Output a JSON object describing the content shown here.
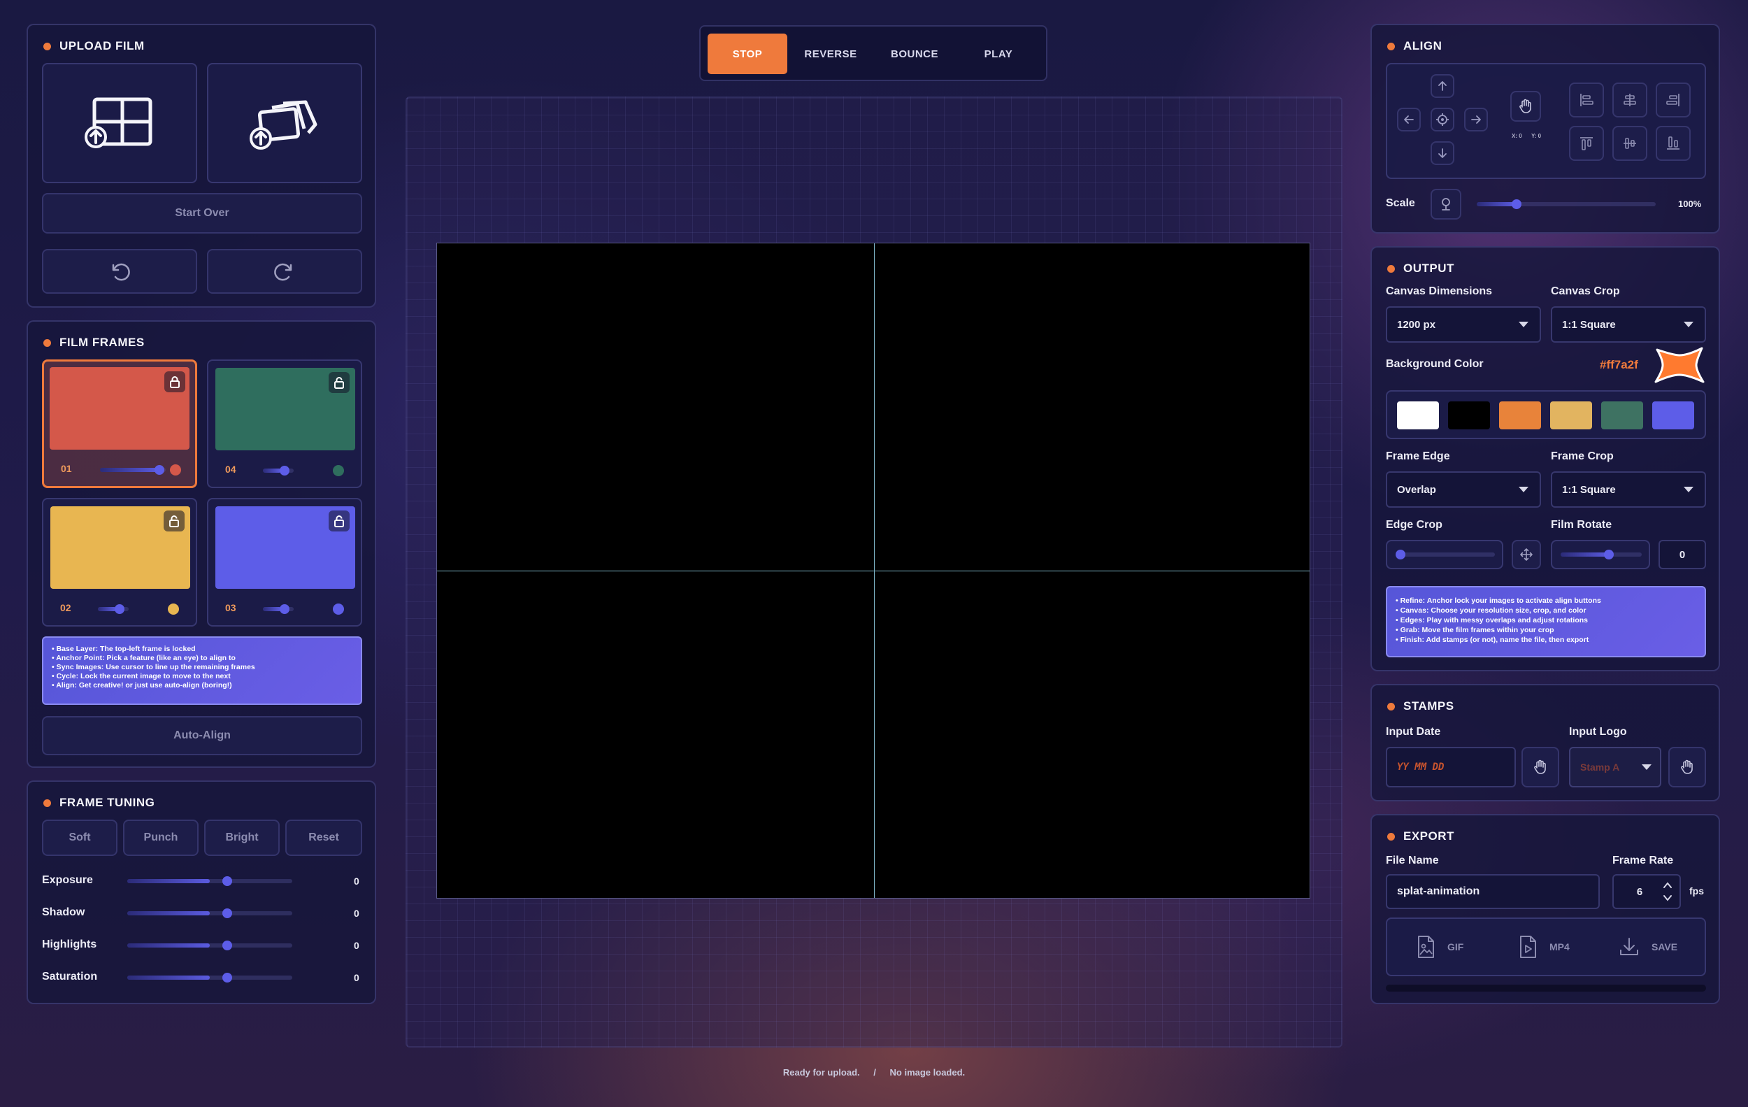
{
  "colors": {
    "accent": "#ef7a3c",
    "primary": "#5d5de8",
    "background": "#ff7a2f"
  },
  "upload": {
    "title": "UPLOAD FILM",
    "start_over": "Start Over",
    "icons": [
      "grid-upload-icon",
      "stack-upload-icon",
      "undo-icon",
      "redo-icon"
    ]
  },
  "frames": {
    "title": "FILM FRAMES",
    "items": [
      {
        "label": "01",
        "color": "#d4584a",
        "slider": 0.9
      },
      {
        "label": "04",
        "color": "#2f6e5e",
        "slider": 0.6
      },
      {
        "label": "02",
        "color": "#e8b651",
        "slider": 0.6
      },
      {
        "label": "03",
        "color": "#5d5de8",
        "slider": 0.6
      }
    ],
    "info": [
      "• Base Layer: The top-left frame is locked",
      "• Anchor Point: Pick a feature (like an eye) to align to",
      "• Sync Images: Use cursor to line up the remaining frames",
      "• Cycle: Lock the current image to move to the next",
      "• Align: Get creative! or just use auto-align (boring!)"
    ],
    "auto_align": "Auto-Align"
  },
  "tuning": {
    "title": "FRAME TUNING",
    "presets": [
      "Soft",
      "Punch",
      "Bright",
      "Reset"
    ],
    "sliders": [
      {
        "label": "Exposure",
        "value": "0",
        "level": 0.5
      },
      {
        "label": "Shadow",
        "value": "0",
        "level": 0.5
      },
      {
        "label": "Highlights",
        "value": "0",
        "level": 0.5
      },
      {
        "label": "Saturation",
        "value": "0",
        "level": 0.5
      }
    ]
  },
  "playback": {
    "tabs": [
      "STOP",
      "REVERSE",
      "BOUNCE",
      "PLAY"
    ],
    "active": "STOP"
  },
  "status": {
    "left": "Ready for upload.",
    "sep": "/",
    "right": "No image loaded."
  },
  "align": {
    "title": "ALIGN",
    "xy": [
      "X: 0",
      "Y: 0"
    ],
    "scale_label": "Scale",
    "scale_value": "100%",
    "scale_level": 0.2
  },
  "output": {
    "title": "OUTPUT",
    "canvas_dimensions_label": "Canvas Dimensions",
    "canvas_dimensions": "1200 px",
    "canvas_crop_label": "Canvas Crop",
    "canvas_crop": "1:1 Square",
    "bg_label": "Background Color",
    "bg_value": "#ff7a2f",
    "swatches": [
      "#ffffff",
      "#000000",
      "#e8833a",
      "#e2b460",
      "#3e7262",
      "#5d5de8"
    ],
    "frame_edge_label": "Frame Edge",
    "frame_edge": "Overlap",
    "frame_crop_label": "Frame Crop",
    "frame_crop": "1:1 Square",
    "edge_crop_label": "Edge Crop",
    "edge_crop_level": 0.0,
    "film_rotate_label": "Film Rotate",
    "film_rotate_value": "0",
    "film_rotate_level": 0.5,
    "info": [
      "• Refine: Anchor lock your images to activate align buttons",
      "• Canvas: Choose your resolution size, crop, and color",
      "• Edges: Play with messy overlaps and adjust rotations",
      "• Grab: Move the film frames within your crop",
      "• Finish: Add stamps (or not), name the file, then export"
    ]
  },
  "stamps": {
    "title": "STAMPS",
    "date_label": "Input Date",
    "date_placeholder": "YY MM DD",
    "logo_label": "Input Logo",
    "logo_value": "Stamp A"
  },
  "export": {
    "title": "EXPORT",
    "file_label": "File Name",
    "file_value": "splat-animation",
    "rate_label": "Frame Rate",
    "rate_value": "6",
    "rate_unit": "fps",
    "gif": "GIF",
    "mp4": "MP4",
    "save": "SAVE"
  }
}
